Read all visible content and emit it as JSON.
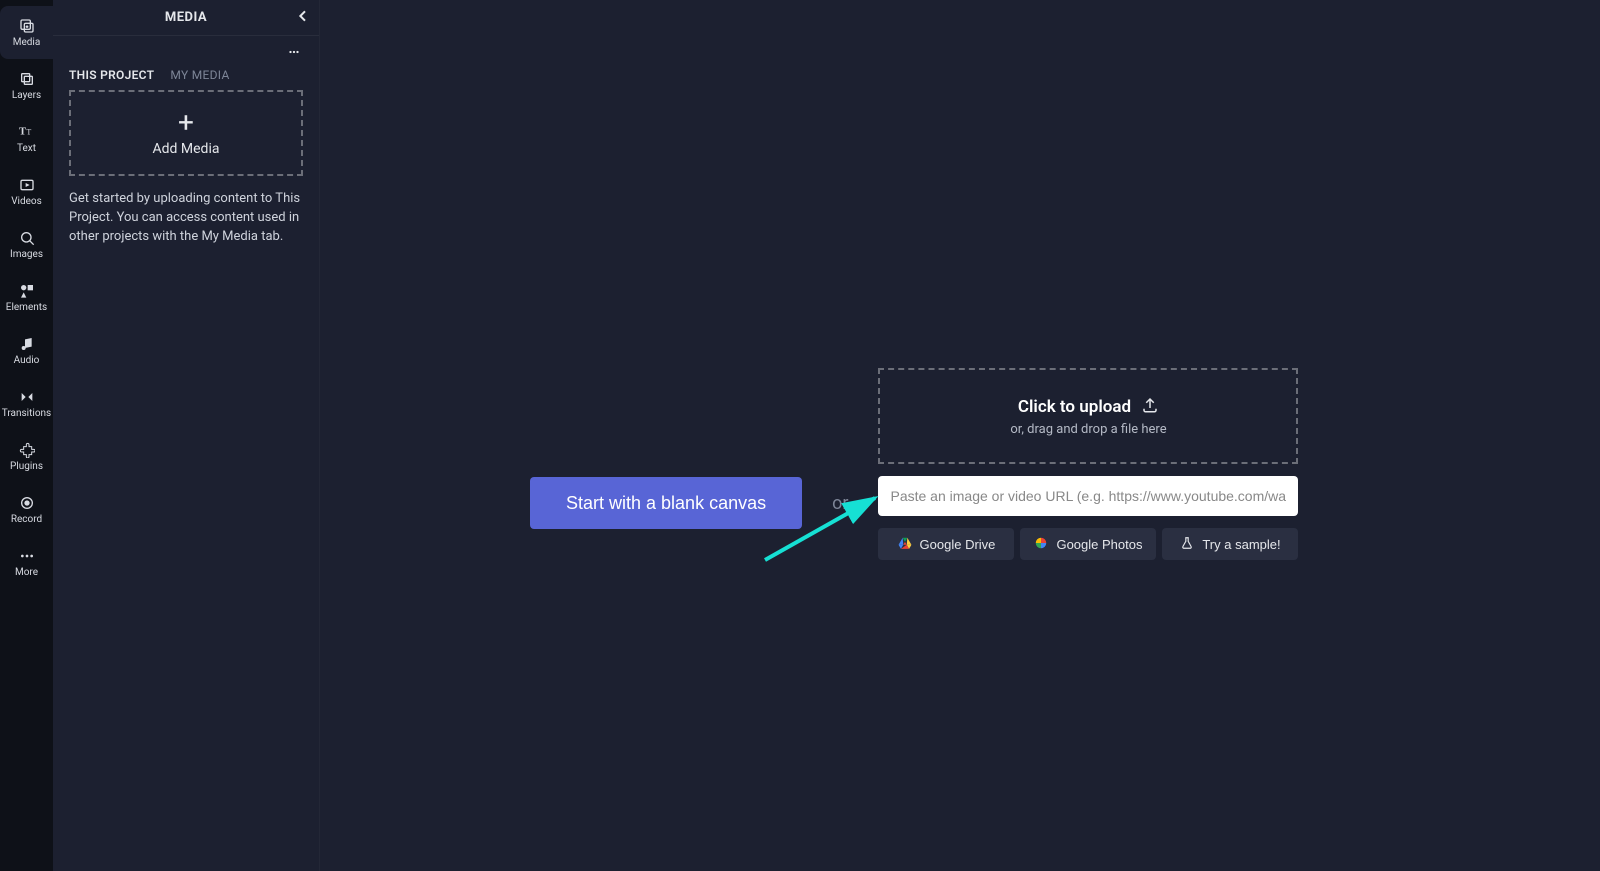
{
  "rail": {
    "media": "Media",
    "layers": "Layers",
    "text": "Text",
    "videos": "Videos",
    "images": "Images",
    "elements": "Elements",
    "audio": "Audio",
    "transitions": "Transitions",
    "plugins": "Plugins",
    "record": "Record",
    "more": "More"
  },
  "panel": {
    "title": "MEDIA",
    "tabs": {
      "this_project": "THIS PROJECT",
      "my_media": "MY MEDIA"
    },
    "add_media": "Add Media",
    "help": "Get started by uploading content to This Project. You can access content used in other projects with the My Media tab."
  },
  "main": {
    "blank_canvas": "Start with a blank canvas",
    "or": "or",
    "upload_title": "Click to upload",
    "upload_sub": "or, drag and drop a file here",
    "url_placeholder": "Paste an image or video URL (e.g. https://www.youtube.com/watch?v=O",
    "google_drive": "Google Drive",
    "google_photos": "Google Photos",
    "try_sample": "Try a sample!"
  }
}
